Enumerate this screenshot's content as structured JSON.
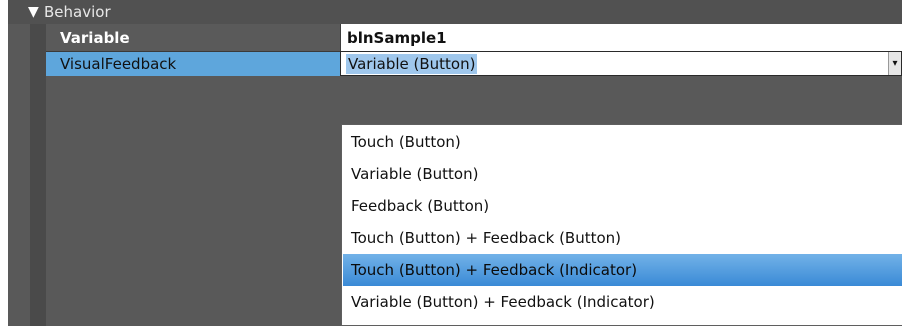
{
  "section": {
    "caret": "▼",
    "title": "Behavior"
  },
  "properties": [
    {
      "label": "Variable",
      "value": "blnSample1"
    },
    {
      "label": "VisualFeedback",
      "value": "Variable (Button)"
    }
  ],
  "combo": {
    "button_glyph": "▾"
  },
  "dropdown": {
    "options": [
      "Touch (Button)",
      "Variable (Button)",
      "Feedback (Button)",
      "Touch (Button) + Feedback (Button)",
      "Touch (Button) + Feedback (Indicator)",
      "Variable (Button) + Feedback (Indicator)"
    ],
    "highlighted_index": 4
  },
  "colors": {
    "selected_row": "#5ea6dc",
    "highlight_item": "#3a8ad6"
  }
}
